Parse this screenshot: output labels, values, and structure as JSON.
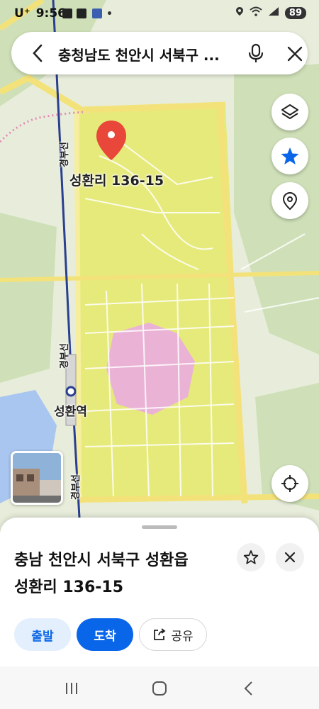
{
  "status": {
    "carrier": "U⁺",
    "time": "9:56",
    "battery": "89"
  },
  "search": {
    "query": "충청남도 천안시 서북구 ..."
  },
  "map": {
    "pin_label": "성환리 136-15",
    "station_label": "성환역",
    "rail_label_1": "경부선",
    "rail_label_2": "경부선",
    "rail_label_3": "경부선"
  },
  "sheet": {
    "address_line1": "충남 천안시 서북구 성환읍",
    "address_line2": "성환리 136-15",
    "depart_label": "출발",
    "arrive_label": "도착",
    "share_label": "공유"
  },
  "colors": {
    "accent": "#0a66e8",
    "pin": "#e8473a",
    "zone_yellow": "#e6ea7a",
    "road": "#f3e27a",
    "rail": "#2a3f8f"
  }
}
